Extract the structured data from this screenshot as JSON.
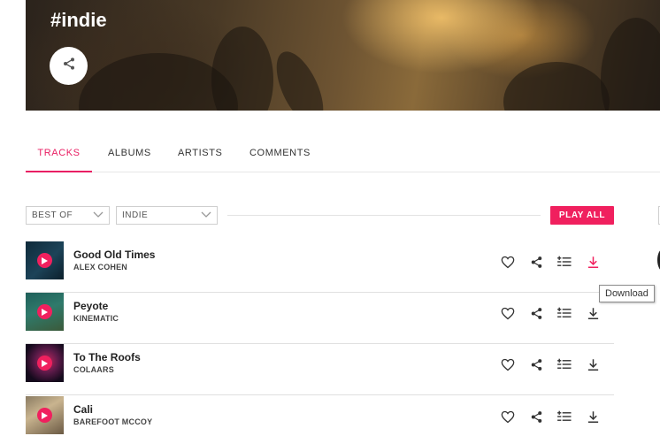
{
  "hero": {
    "title": "#indie",
    "share_icon": "share-icon"
  },
  "tabs": [
    {
      "label": "TRACKS",
      "active": true
    },
    {
      "label": "ALBUMS",
      "active": false
    },
    {
      "label": "ARTISTS",
      "active": false
    },
    {
      "label": "COMMENTS",
      "active": false
    }
  ],
  "filters": {
    "sort_value": "BEST OF",
    "tag_value": "INDIE",
    "play_all_label": "PLAY ALL"
  },
  "tracks": [
    {
      "title": "Good Old Times",
      "artist": "ALEX COHEN",
      "download_highlighted": true
    },
    {
      "title": "Peyote",
      "artist": "KINEMATIC",
      "download_highlighted": false
    },
    {
      "title": "To The Roofs",
      "artist": "COLAARS",
      "download_highlighted": false
    },
    {
      "title": "Cali",
      "artist": "BAREFOOT MCCOY",
      "download_highlighted": false
    }
  ],
  "tooltip": {
    "text": "Download"
  },
  "colors": {
    "accent": "#f0205e",
    "icon": "#333333",
    "divider": "#e0e0e0"
  }
}
